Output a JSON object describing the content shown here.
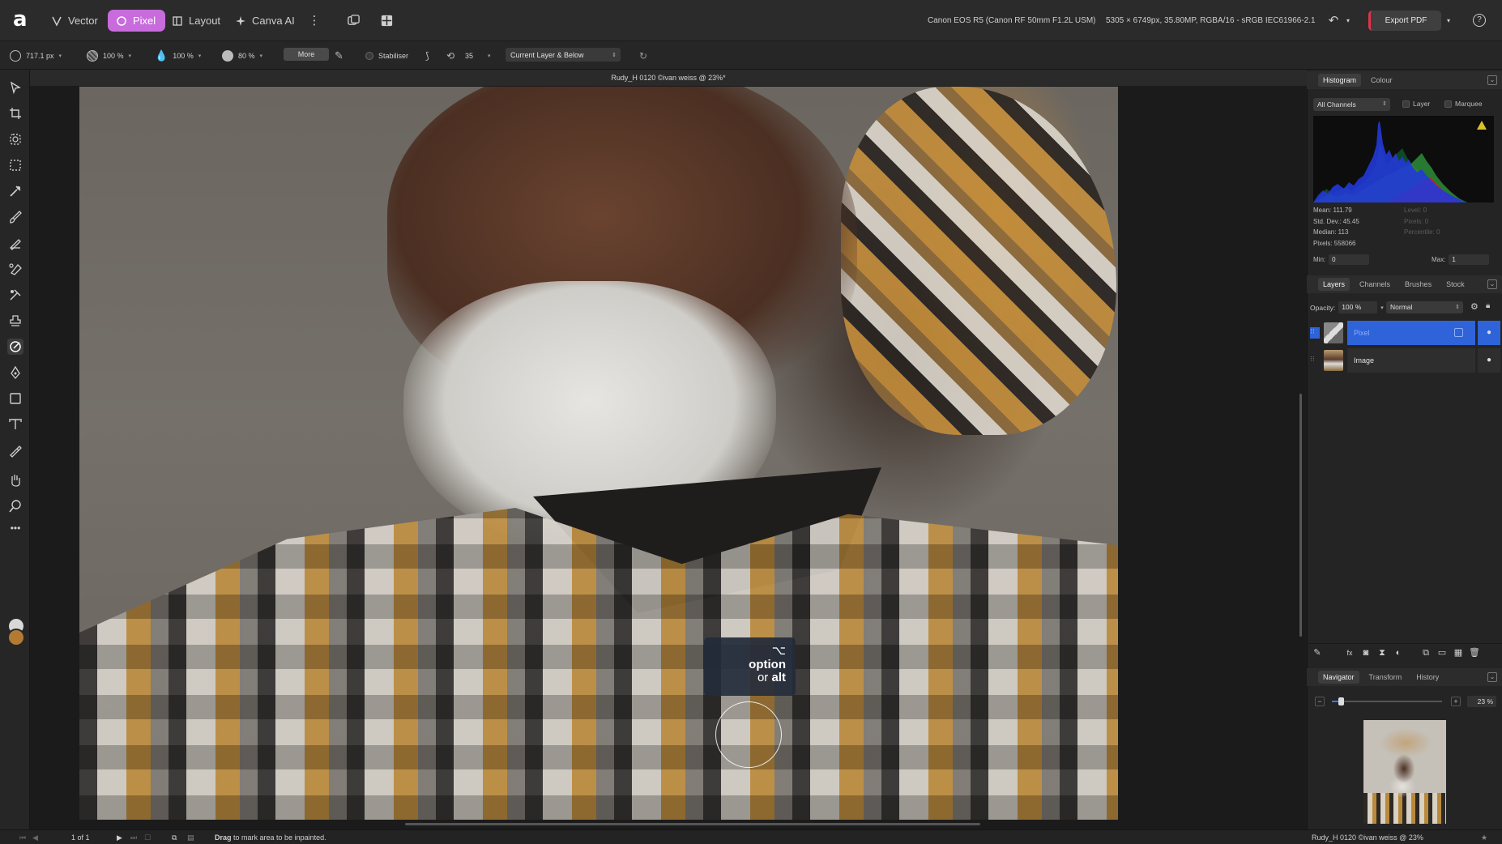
{
  "app": {
    "personas": [
      {
        "label": "Vector",
        "icon": "vector-persona-icon",
        "active": false
      },
      {
        "label": "Pixel",
        "icon": "pixel-persona-icon",
        "active": true
      },
      {
        "label": "Layout",
        "icon": "layout-persona-icon",
        "active": false
      },
      {
        "label": "Canva AI",
        "icon": "canva-ai-icon",
        "active": false
      }
    ],
    "camera_info": "Canon EOS R5 (Canon RF 50mm F1.2L USM)",
    "image_info": "5305 × 6749px, 35.80MP, RGBA/16 - sRGB IEC61966-2.1",
    "export_label": "Export PDF",
    "help_label": "?"
  },
  "context_toolbar": {
    "width": "717.1 px",
    "opacity": "100 %",
    "flow": "100 %",
    "hardness": "80 %",
    "more_label": "More",
    "stabiliser_label": "Stabiliser",
    "stabiliser_value": "35",
    "sample_mode": "Current Layer & Below"
  },
  "document": {
    "title": "Rudy_H 0120 ©ivan weiss @ 23%*"
  },
  "canvas_overlay": {
    "modifier_symbol": "⌥",
    "modifier_line1": "option",
    "modifier_line2_prefix": "or",
    "modifier_line2_key": "alt"
  },
  "status_bar": {
    "page": "1 of 1",
    "hint_strong": "Drag",
    "hint_rest": "to mark area to be inpainted.",
    "right_text": "Rudy_H 0120 ©ivan weiss @ 23%"
  },
  "histogram_panel": {
    "tabs": [
      "Histogram",
      "Colour"
    ],
    "channel": "All Channels",
    "check_layer": "Layer",
    "check_marquee": "Marquee",
    "stats": [
      "Mean: 111.79",
      "Std. Dev.: 45.45",
      "Median: 113",
      "Pixels: 558066"
    ],
    "stats_dim": [
      "Level: 0",
      "Pixels: 0",
      "Percentile: 0"
    ],
    "min_label": "Min:",
    "min_value": "0",
    "max_label": "Max:",
    "max_value": "1"
  },
  "layers_panel": {
    "tabs": [
      "Layers",
      "Channels",
      "Brushes",
      "Stock"
    ],
    "opacity_label": "Opacity:",
    "opacity_value": "100 %",
    "blend_mode": "Normal",
    "layers": [
      {
        "name": "Pixel",
        "selected": true
      },
      {
        "name": "Image",
        "selected": false
      }
    ]
  },
  "navigator_panel": {
    "tabs": [
      "Navigator",
      "Transform",
      "History"
    ],
    "zoom_value": "23 %",
    "zoom_fraction": 0.08
  },
  "colors": {
    "accent_pixel": "#c86bdc",
    "selection": "#2e63d9",
    "export_accent": "#e0344c",
    "foreground_color": "#b37a33",
    "background_color": "#d8d8d8"
  },
  "tools": [
    "move-tool-icon",
    "crop-tool-icon",
    "selection-brush-icon",
    "rectangular-marquee-icon",
    "flood-select-icon",
    "paint-brush-icon",
    "pixel-tool-icon",
    "erase-brush-icon",
    "dodge-brush-icon",
    "clone-brush-icon",
    "inpainting-brush-icon",
    "pen-tool-icon",
    "shape-tool-icon",
    "text-tool-icon",
    "color-picker-icon",
    "hand-tool-icon",
    "zoom-tool-icon"
  ]
}
